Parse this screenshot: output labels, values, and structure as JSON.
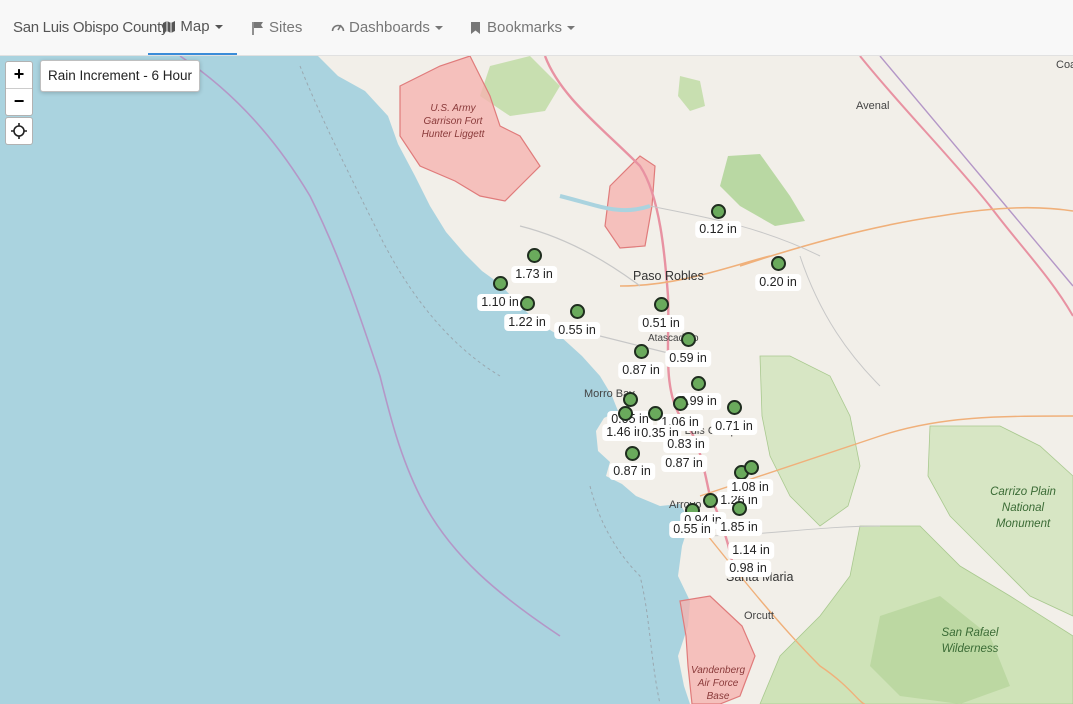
{
  "nav": {
    "brand": "San Luis Obispo County",
    "map": "Map",
    "sites": "Sites",
    "dashboards": "Dashboards",
    "bookmarks": "Bookmarks"
  },
  "map": {
    "layer_label": "Rain Increment - 6 Hour",
    "zoom_in": "+",
    "zoom_out": "−",
    "places": {
      "avenal": "Avenal",
      "paso_robles": "Paso Robles",
      "atascadero": "Atascadero",
      "morro_bay": "Morro Bay",
      "san_luis": "San Luis Obispo",
      "arroyo_grande": "Arroyo Grande",
      "santa_maria": "Santa Maria",
      "orcutt": "Orcutt",
      "coalinga": "Coalinga"
    },
    "areas": {
      "hunter_liggett": "U.S. Army Garrison Fort Hunter Liggett",
      "carrizo": "Carrizo Plain National Monument",
      "san_rafael": "San Rafael Wilderness",
      "vandenberg": "Vandenberg Air Force Base"
    },
    "rain_values": [
      "0.12 in",
      "1.73 in",
      "0.20 in",
      "1.10 in",
      "1.22 in",
      "0.55 in",
      "0.51 in",
      "0.59 in",
      "0.87 in",
      "0.99 in",
      "0.05 in",
      "1.06 in",
      "0.71 in",
      "1.46 in",
      "0.35 in",
      "0.83 in",
      "0.87 in",
      "0.87 in",
      "1.08 in",
      "1.26 in",
      "0.94 in",
      "0.55 in",
      "1.85 in",
      "1.14 in",
      "0.98 in"
    ]
  },
  "colors": {
    "water": "#aad3df",
    "land": "#f2efe9",
    "site_fill": "#6aaa5c",
    "military": "#f5a3a3",
    "accent": "#3b8cd8"
  }
}
